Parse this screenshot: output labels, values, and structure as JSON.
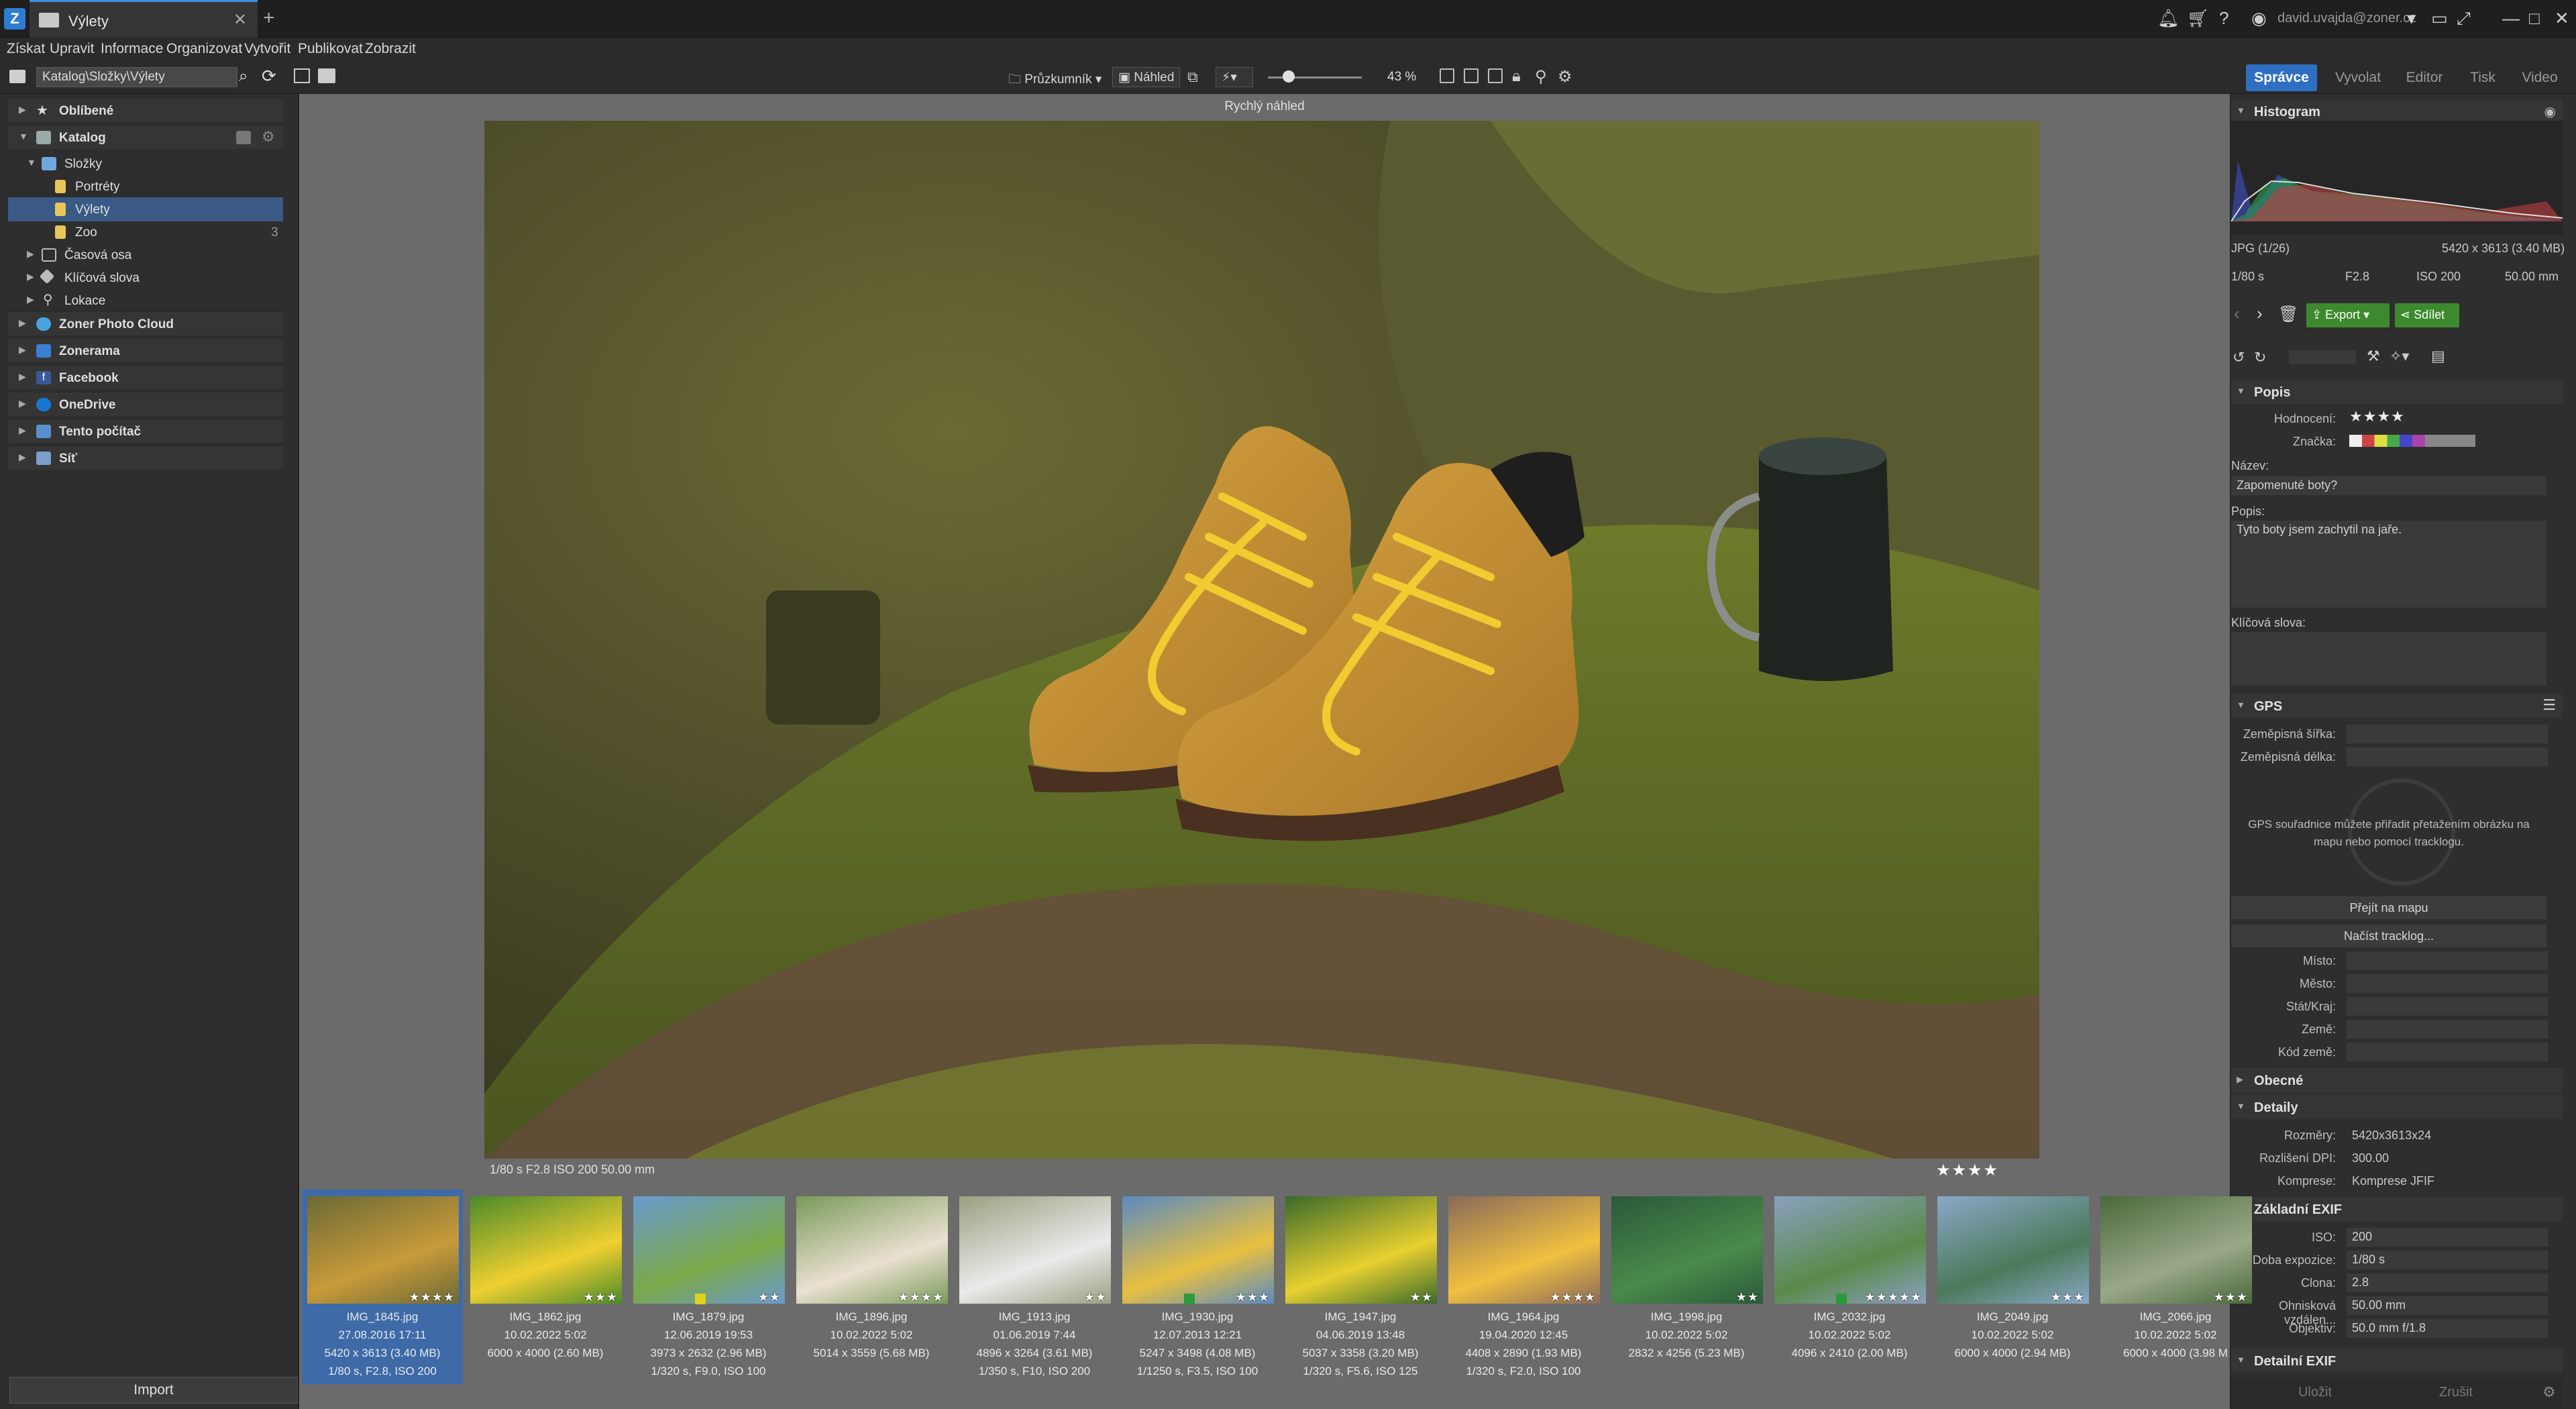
{
  "window": {
    "tab_title": "Výlety",
    "user_email": "david.uvajda@zoner.cz"
  },
  "menu": [
    "Získat",
    "Upravit",
    "Informace",
    "Organizovat",
    "Vytvořit",
    "Publikovat",
    "Zobrazit"
  ],
  "toolbar": {
    "path": "Katalog\\Složky\\Výlety",
    "pruzkumnik": "Průzkumník",
    "nahled": "Náhled",
    "zoom": "43 %"
  },
  "modules": [
    "Správce",
    "Vyvolat",
    "Editor",
    "Tisk",
    "Video"
  ],
  "nav": {
    "favorites": "Oblíbené",
    "catalog": "Katalog",
    "folders": "Složky",
    "folder_items": [
      {
        "label": "Portréty",
        "count": ""
      },
      {
        "label": "Výlety",
        "count": ""
      },
      {
        "label": "Zoo",
        "count": "3"
      }
    ],
    "timeline": "Časová osa",
    "keywords": "Klíčová slova",
    "locations": "Lokace",
    "sections": [
      "Zoner Photo Cloud",
      "Zonerama",
      "Facebook",
      "OneDrive",
      "Tento počítač",
      "Síť"
    ],
    "import": "Import"
  },
  "preview": {
    "title": "Rychlý náhled",
    "exif": "1/80 s   F2.8   ISO 200   50.00 mm",
    "rating": "★★★★"
  },
  "thumbnails": [
    {
      "name": "IMG_1845.jpg",
      "date": "27.08.2016 17:11",
      "size": "5420 x 3613 (3.40 MB)",
      "exif": "1/80 s, F2.8, ISO 200",
      "stars": "★★★★",
      "tag": ""
    },
    {
      "name": "IMG_1862.jpg",
      "date": "10.02.2022 5:02",
      "size": "6000 x 4000 (2.60 MB)",
      "exif": "",
      "stars": "★★★",
      "tag": ""
    },
    {
      "name": "IMG_1879.jpg",
      "date": "12.06.2019 19:53",
      "size": "3973 x 2632 (2.96 MB)",
      "exif": "1/320 s, F9.0, ISO 100",
      "stars": "★★",
      "tag": "#e0d020"
    },
    {
      "name": "IMG_1896.jpg",
      "date": "10.02.2022 5:02",
      "size": "5014 x 3559 (5.68 MB)",
      "exif": "",
      "stars": "★★★★",
      "tag": ""
    },
    {
      "name": "IMG_1913.jpg",
      "date": "01.06.2019 7:44",
      "size": "4896 x 3264 (3.61 MB)",
      "exif": "1/350 s, F10, ISO 200",
      "stars": "★★",
      "tag": ""
    },
    {
      "name": "IMG_1930.jpg",
      "date": "12.07.2013 12:21",
      "size": "5247 x 3498 (4.08 MB)",
      "exif": "1/1250 s, F3.5, ISO 100",
      "stars": "★★★",
      "tag": "#2a9a3a"
    },
    {
      "name": "IMG_1947.jpg",
      "date": "04.06.2019 13:48",
      "size": "5037 x 3358 (3.20 MB)",
      "exif": "1/320 s, F5.6, ISO 125",
      "stars": "★★",
      "tag": ""
    },
    {
      "name": "IMG_1964.jpg",
      "date": "19.04.2020 12:45",
      "size": "4408 x 2890 (1.93 MB)",
      "exif": "1/320 s, F2.0, ISO 100",
      "stars": "★★★★",
      "tag": ""
    },
    {
      "name": "IMG_1998.jpg",
      "date": "10.02.2022 5:02",
      "size": "2832 x 4256 (5.23 MB)",
      "exif": "",
      "stars": "★★",
      "tag": ""
    },
    {
      "name": "IMG_2032.jpg",
      "date": "10.02.2022 5:02",
      "size": "4096 x 2410 (2.00 MB)",
      "exif": "",
      "stars": "★★★★★",
      "tag": "#2a9a3a"
    },
    {
      "name": "IMG_2049.jpg",
      "date": "10.02.2022 5:02",
      "size": "6000 x 4000 (2.94 MB)",
      "exif": "",
      "stars": "★★★",
      "tag": ""
    },
    {
      "name": "IMG_2066.jpg",
      "date": "10.02.2022 5:02",
      "size": "6000 x 4000 (3.98 M",
      "exif": "",
      "stars": "★★★",
      "tag": ""
    }
  ],
  "right": {
    "histogram_title": "Histogram",
    "file_info": "JPG  (1/26)",
    "file_dims": "5420 x 3613 (3.40 MB)",
    "shot": {
      "shutter": "1/80 s",
      "aperture": "F2.8",
      "iso": "ISO 200",
      "focal": "50.00 mm"
    },
    "export": "Export",
    "share": "Sdílet",
    "popis_title": "Popis",
    "rating_label": "Hodnocení:",
    "rating": "★★★★",
    "tag_label": "Značka:",
    "name_label": "Název:",
    "name_value": "Zapomenuté boty?",
    "desc_label": "Popis:",
    "desc_value": "Tyto boty jsem zachytil na jaře.",
    "keywords_label": "Klíčová slova:",
    "gps_title": "GPS",
    "lat_label": "Zeměpisná šířka:",
    "lon_label": "Zeměpisná délka:",
    "gps_hint": "GPS souřadnice můžete přiřadit přetažením obrázku na mapu nebo pomocí tracklogu.",
    "btn_map": "Přejít na mapu",
    "btn_tracklog": "Načíst tracklog...",
    "place_label": "Místo:",
    "city_label": "Město:",
    "state_label": "Stát/Kraj:",
    "country_label": "Země:",
    "country_code_label": "Kód země:",
    "general_title": "Obecné",
    "details_title": "Detaily",
    "dims_label": "Rozměry:",
    "dims_value": "5420x3613x24",
    "dpi_label": "Rozlišení DPI:",
    "dpi_value": "300.00",
    "compression_label": "Komprese:",
    "compression_value": "Komprese JFIF",
    "exif_title": "Základní EXIF",
    "iso_label": "ISO:",
    "iso_value": "200",
    "exposure_label": "Doba expozice:",
    "exposure_value": "1/80 s",
    "aperture_label": "Clona:",
    "aperture_value": "2.8",
    "focus_dist_label": "Ohnisková vzdálen...",
    "focus_dist_value": "50.00 mm",
    "lens_label": "Objektiv:",
    "lens_value": "50.0 mm f/1.8",
    "detail_exif_title": "Detailní EXIF",
    "save": "Uložit",
    "cancel": "Zrušit"
  }
}
